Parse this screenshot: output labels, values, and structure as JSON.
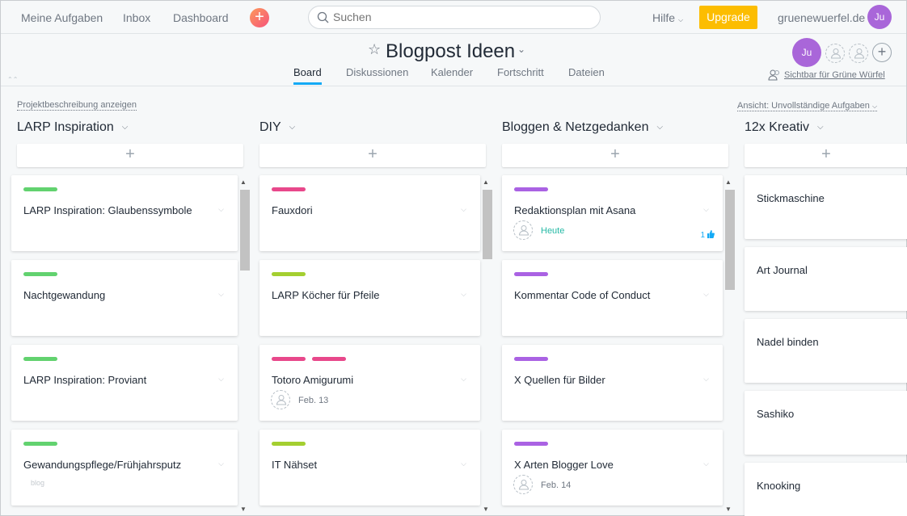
{
  "topbar": {
    "my_tasks": "Meine Aufgaben",
    "inbox": "Inbox",
    "dashboard": "Dashboard",
    "add": "+",
    "search_placeholder": "Suchen",
    "help": "Hilfe",
    "upgrade": "Upgrade",
    "domain": "gruenewuerfel.de",
    "avatar": "Ju"
  },
  "project": {
    "title": "Blogpost Ideen",
    "tabs": [
      "Board",
      "Diskussionen",
      "Kalender",
      "Fortschritt",
      "Dateien"
    ],
    "member_avatar": "Ju",
    "add_member": "+",
    "visibility": "Sichtbar für Grüne Würfel"
  },
  "board": {
    "show_description": "Projektbeschreibung anzeigen",
    "view_filter": "Ansicht: Unvollständige Aufgaben",
    "add_task": "+",
    "columns": [
      {
        "title": "LARP Inspiration",
        "cards": [
          {
            "name": "LARP Inspiration: Glaubenssymbole",
            "tags": [
              "#62d26f"
            ]
          },
          {
            "name": "Nachtgewandung",
            "tags": [
              "#62d26f"
            ]
          },
          {
            "name": "LARP Inspiration: Proviant",
            "tags": [
              "#62d26f"
            ]
          },
          {
            "name": "Gewandungspflege/Frühjahrsputz",
            "tags": [
              "#62d26f"
            ],
            "badge": "blog"
          }
        ]
      },
      {
        "title": "DIY",
        "cards": [
          {
            "name": "Fauxdori",
            "tags": [
              "#e8488b"
            ]
          },
          {
            "name": "LARP Köcher für Pfeile",
            "tags": [
              "#a4cf30"
            ]
          },
          {
            "name": "Totoro Amigurumi",
            "tags": [
              "#e8488b",
              "#e8488b"
            ],
            "due": "Feb. 13"
          },
          {
            "name": "IT Nähset",
            "tags": [
              "#a4cf30"
            ]
          }
        ]
      },
      {
        "title": "Bloggen & Netzgedanken",
        "cards": [
          {
            "name": "Redaktionsplan mit Asana",
            "tags": [
              "#aa62e3"
            ],
            "due": "Heute",
            "likes": "1"
          },
          {
            "name": "Kommentar Code of Conduct",
            "tags": [
              "#aa62e3"
            ]
          },
          {
            "name": "X Quellen für Bilder",
            "tags": [
              "#aa62e3"
            ]
          },
          {
            "name": "X Arten Blogger Love",
            "tags": [
              "#aa62e3"
            ],
            "due": "Feb. 14"
          }
        ]
      },
      {
        "title": "12x Kreativ",
        "cards": [
          {
            "name": "Stickmaschine"
          },
          {
            "name": "Art Journal"
          },
          {
            "name": "Nadel binden"
          },
          {
            "name": "Sashiko"
          },
          {
            "name": "Knooking"
          }
        ]
      }
    ]
  },
  "colors": {
    "accent": "#14aaf5",
    "upgrade": "#fcbd01",
    "avatar": "#a966d9",
    "green_tag": "#62d26f",
    "pink_tag": "#e8488b",
    "lime_tag": "#a4cf30",
    "purple_tag": "#aa62e3"
  }
}
